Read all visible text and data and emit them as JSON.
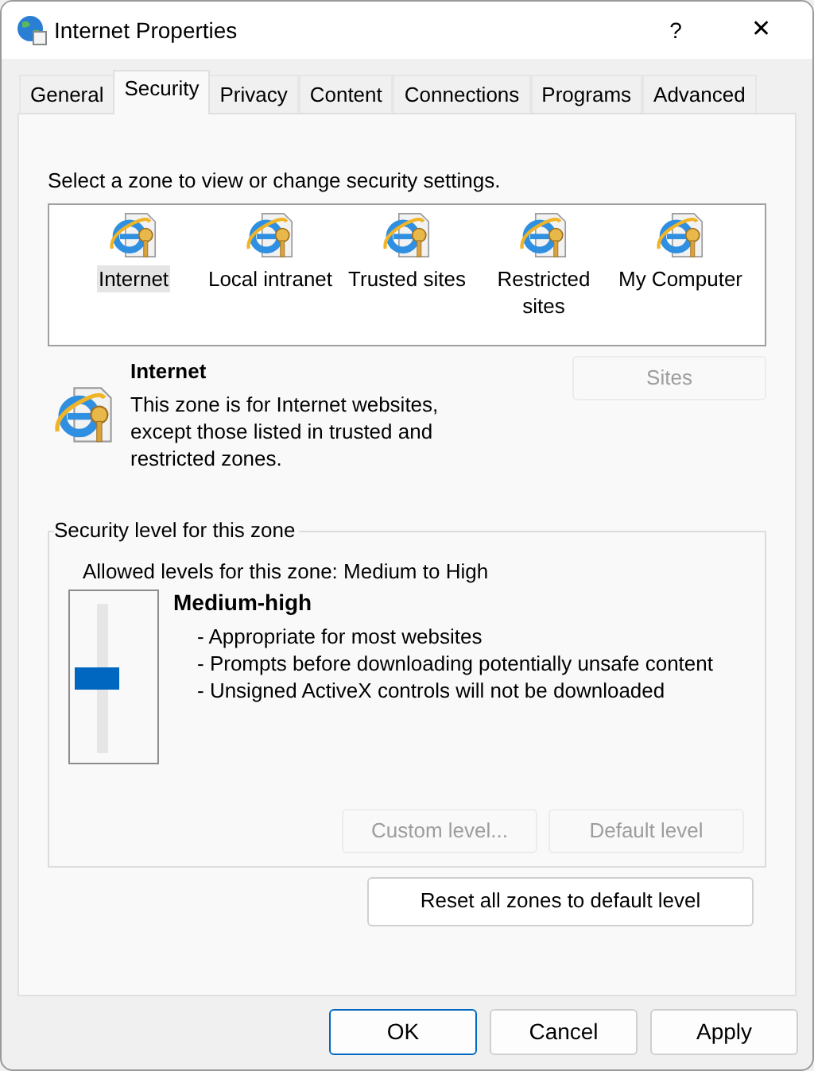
{
  "window": {
    "title": "Internet Properties",
    "help": "?",
    "close": "✕"
  },
  "tabs": [
    {
      "label": "General",
      "selected": false
    },
    {
      "label": "Security",
      "selected": true
    },
    {
      "label": "Privacy",
      "selected": false
    },
    {
      "label": "Content",
      "selected": false
    },
    {
      "label": "Connections",
      "selected": false
    },
    {
      "label": "Programs",
      "selected": false
    },
    {
      "label": "Advanced",
      "selected": false
    }
  ],
  "zone_prompt": "Select a zone to view or change security settings.",
  "zones": [
    {
      "label": "Internet",
      "selected": true
    },
    {
      "label": "Local intranet",
      "selected": false
    },
    {
      "label": "Trusted sites",
      "selected": false
    },
    {
      "label": "Restricted sites",
      "selected": false
    },
    {
      "label": "My Computer",
      "selected": false
    }
  ],
  "zone_info": {
    "title": "Internet",
    "description": "This zone is for Internet websites, except those listed in trusted and restricted zones.",
    "sites_button": {
      "label": "Sites",
      "disabled": true
    }
  },
  "security": {
    "group_label": "Security level for this zone",
    "allowed": "Allowed levels for this zone: Medium to High",
    "level": 0.5,
    "level_name": "Medium-high",
    "bullets": [
      "- Appropriate for most websites",
      "- Prompts before downloading potentially unsafe content",
      "- Unsigned ActiveX controls will not be downloaded"
    ],
    "buttons": [
      {
        "label": "Custom level...",
        "disabled": true
      },
      {
        "label": "Default level",
        "disabled": true
      }
    ]
  },
  "reset_button": {
    "label": "Reset all zones to default level",
    "disabled": false
  },
  "dialog_buttons": [
    {
      "label": "OK",
      "default": true
    },
    {
      "label": "Cancel",
      "default": false
    },
    {
      "label": "Apply",
      "default": false
    }
  ]
}
